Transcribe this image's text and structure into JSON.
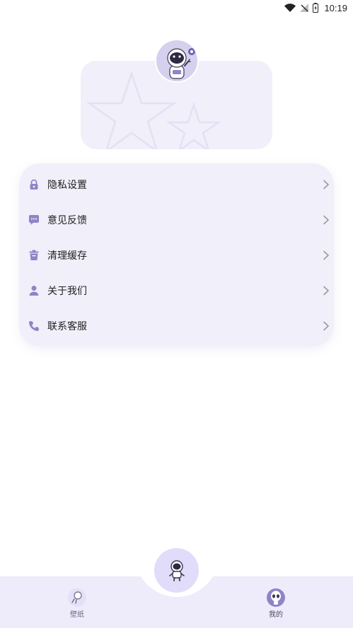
{
  "status_bar": {
    "time": "10:19"
  },
  "menu": {
    "items": [
      {
        "label": "隐私设置",
        "icon": "lock-icon"
      },
      {
        "label": "意见反馈",
        "icon": "chat-bubble-icon"
      },
      {
        "label": "清理缓存",
        "icon": "trash-icon"
      },
      {
        "label": "关于我们",
        "icon": "person-icon"
      },
      {
        "label": "联系客服",
        "icon": "phone-icon"
      }
    ]
  },
  "bottom_nav": {
    "tabs": [
      {
        "label": "壁纸",
        "icon": "astronaut-icon"
      },
      {
        "label": "我的",
        "icon": "alien-icon",
        "active": true
      }
    ],
    "center_icon": "astronaut-icon"
  },
  "colors": {
    "accent": "#8f84c8",
    "card_bg": "#f1effa",
    "nav_bg": "#eeecfa"
  }
}
